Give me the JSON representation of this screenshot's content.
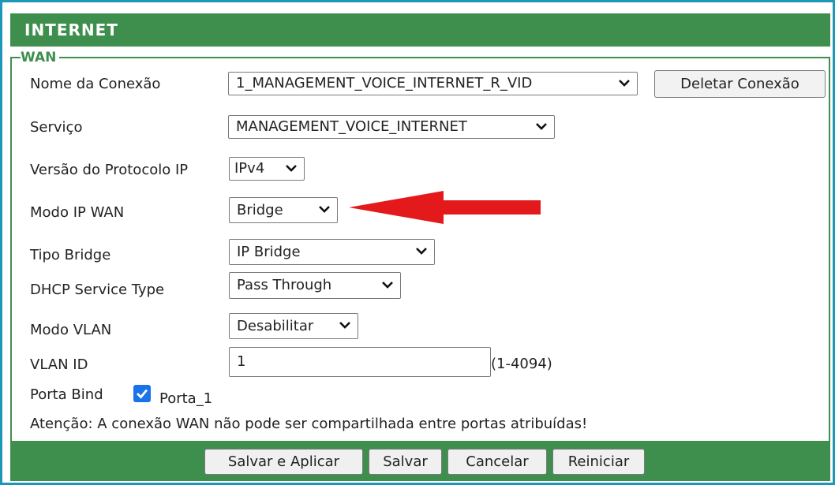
{
  "header": {
    "title": "INTERNET"
  },
  "section": {
    "label": "WAN"
  },
  "form": {
    "connection_name": {
      "label": "Nome da Conexão",
      "value": "1_MANAGEMENT_VOICE_INTERNET_R_VID"
    },
    "delete_button": "Deletar Conexão",
    "service": {
      "label": "Serviço",
      "value": "MANAGEMENT_VOICE_INTERNET"
    },
    "ip_protocol": {
      "label": "Versão do Protocolo IP",
      "value": "IPv4"
    },
    "wan_ip_mode": {
      "label": "Modo IP WAN",
      "value": "Bridge"
    },
    "bridge_type": {
      "label": "Tipo Bridge",
      "value": "IP Bridge"
    },
    "dhcp_service_type": {
      "label": "DHCP Service Type",
      "value": "Pass Through"
    },
    "vlan_mode": {
      "label": "Modo VLAN",
      "value": "Desabilitar"
    },
    "vlan_id": {
      "label": "VLAN ID",
      "value": "1",
      "range_hint": "(1-4094)"
    },
    "port_bind": {
      "label": "Porta Bind",
      "option_label": "Porta_1",
      "checked": true
    },
    "warning": "Atenção: A conexão WAN não pode ser compartilhada entre portas atribuídas!"
  },
  "footer": {
    "save_apply": "Salvar e Aplicar",
    "save": "Salvar",
    "cancel": "Cancelar",
    "restart": "Reiniciar"
  },
  "colors": {
    "header_green": "#3e8f4e",
    "frame_blue": "#1d97b8",
    "arrow_red": "#e3191c",
    "checkbox_blue": "#1a73e8"
  },
  "icons": {
    "dropdown": "chevron-down-icon",
    "annotation": "arrow-left-icon",
    "checkbox": "checkmark-icon"
  }
}
